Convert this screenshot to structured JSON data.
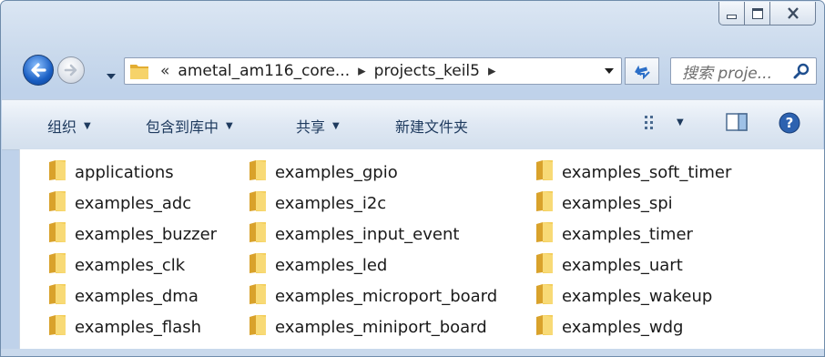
{
  "window": {
    "caption_buttons": [
      "minimize",
      "maximize",
      "close"
    ]
  },
  "nav": {
    "back_icon": "back-arrow-icon",
    "forward_icon": "forward-arrow-icon",
    "address": {
      "prefix": "«",
      "segments": [
        "ametal_am116_core...",
        "projects_keil5"
      ]
    },
    "search_placeholder": "搜索 proje..."
  },
  "toolbar": {
    "organize": "组织",
    "include_in_library": "包含到库中",
    "share": "共享",
    "new_folder": "新建文件夹"
  },
  "files": {
    "col1": [
      "applications",
      "examples_adc",
      "examples_buzzer",
      "examples_clk",
      "examples_dma",
      "examples_flash"
    ],
    "col2": [
      "examples_gpio",
      "examples_i2c",
      "examples_input_event",
      "examples_led",
      "examples_microport_board",
      "examples_miniport_board"
    ],
    "col3": [
      "examples_soft_timer",
      "examples_spi",
      "examples_timer",
      "examples_uart",
      "examples_wakeup",
      "examples_wdg"
    ]
  },
  "colors": {
    "folder": "#f0c24a",
    "toolbar_text": "#1e3a5e",
    "frame": "#c9d9ec"
  }
}
